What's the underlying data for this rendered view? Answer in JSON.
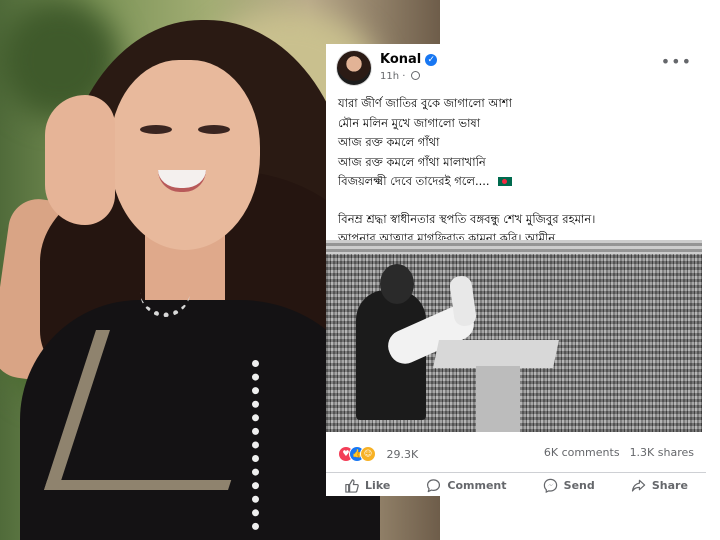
{
  "post": {
    "author": "Konal",
    "timestamp": "11h",
    "verified_icon": "verified-check-icon",
    "privacy_icon": "globe-icon",
    "menu_label": "•••",
    "lines": [
      "যারা জীর্ণ জাতির বুকে জাগালো আশা",
      "মৌন মলিন মুখে জাগালো ভাষা",
      "আজ রক্ত কমলে গাঁথা",
      "আজ রক্ত কমলে গাঁথা মালাখানি",
      "বিজয়লক্ষ্মী দেবে তাদেরই গলে....",
      "বিনম্র শ্রদ্ধা স্বাধীনতার স্থপতি বঙ্গবন্ধু শেখ মুজিবুর রহমান।",
      "আপনার আত্মার মাগফিরাত কামনা করি। আমীন"
    ],
    "flag_icon": "bangladesh-flag-icon"
  },
  "stats": {
    "reaction_icons": [
      "love-reaction-icon",
      "like-reaction-icon",
      "care-reaction-icon"
    ],
    "reactions": "29.3K",
    "comments": "6K comments",
    "shares": "1.3K shares"
  },
  "actions": {
    "like": "Like",
    "comment": "Comment",
    "send": "Send",
    "share": "Share"
  },
  "colors": {
    "facebook_blue": "#1877f2",
    "meta_gray": "#65676b",
    "divider": "#ced0d4"
  }
}
